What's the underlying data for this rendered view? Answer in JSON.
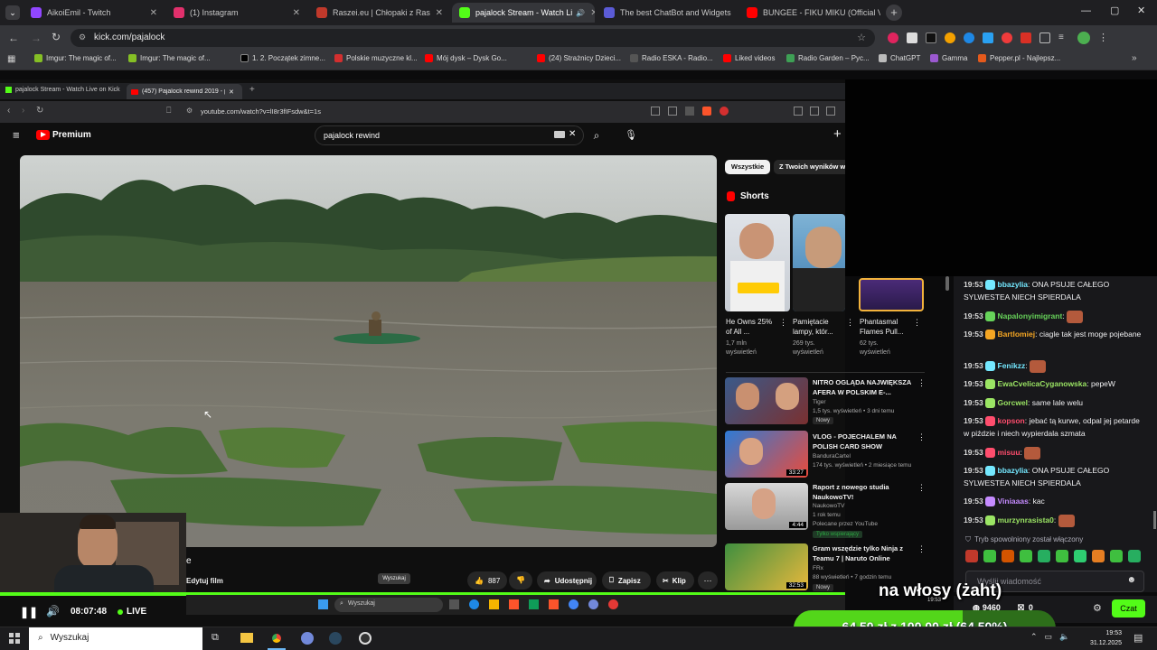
{
  "browser_tabs": [
    {
      "label": "AikoiEmil - Twitch",
      "color": "#9146ff"
    },
    {
      "label": "(1) Instagram",
      "color": "#e1306c"
    },
    {
      "label": "Raszei.eu | Chłopaki z Raszei Lin",
      "color": "#c0392b"
    },
    {
      "label": "pajalock Stream - Watch Li",
      "color": "#53fc18"
    },
    {
      "label": "The best ChatBot and Widgets",
      "color": "#5b5bd6"
    },
    {
      "label": "BUNGEE - FIKU MIKU (Official V",
      "color": "#ff0000"
    }
  ],
  "address": {
    "url": "kick.com/pajalock"
  },
  "bookmarks": [
    "Imgur: The magic of...",
    "Imgur: The magic of...",
    "1. 2. Początek zimne...",
    "Polskie muzyczne kl...",
    "Mój dysk – Dysk Go...",
    "(24) Strażnicy Dzieci...",
    "Radio ESKA - Radio...",
    "Liked videos",
    "Radio Garden – Pyc...",
    "ChatGPT",
    "Gamma",
    "Pepper.pl - Najlepsz..."
  ],
  "inner": {
    "tabs": [
      "pajalock Stream - Watch Live on Kick",
      "(457) Pajalock rewind 2019 - po"
    ],
    "url": "youtube.com/watch?v=lI8r3fIFsdw&t=1s",
    "yt_logo": "Premium",
    "search_value": "pajalock rewind",
    "filters": [
      "Wszystkie",
      "Z Twoich wyników wy"
    ],
    "shorts_title": "Shorts",
    "shorts": [
      {
        "title": "He Owns 25% of All ...",
        "views": "1,7 mln wyświetleń"
      },
      {
        "title": "Pamiętacie lampy, któr...",
        "views": "269 tys. wyświetleń"
      },
      {
        "title": "Phantasmal Flames Pull...",
        "views": "62 tys. wyświetleń"
      }
    ],
    "related": [
      {
        "title": "NITRO OGLĄDA NAJWIĘKSZA AFERA W POLSKIM E-...",
        "channel": "Tiger",
        "meta": "1,5 tys. wyświetleń • 3 dni temu",
        "badge": "Nowy"
      },
      {
        "title": "VLOG - POJECHALEM NA POLISH CARD SHOW",
        "channel": "BanduraCartel",
        "meta": "174 tys. wyświetleń • 2 miesiące temu",
        "duration": "33:27"
      },
      {
        "title": "Raport z nowego studia NaukowoTV!",
        "channel": "NaukowoTV",
        "meta": "1 rok temu",
        "note": "Polecane przez YouTube",
        "badge": "Tylko wspierający",
        "duration": "4:44"
      },
      {
        "title": "Gram wszędzie tylko Ninja z Teamu 7 | Naruto Online",
        "channel": "FRx",
        "meta": "88 wyświetleń • 7 godzin temu",
        "badge": "Nowy",
        "duration": "32:53"
      }
    ],
    "actions": {
      "edit": "Edytuj film",
      "likes": "887",
      "share": "Udostępnij",
      "save": "Zapisz",
      "clip": "Klip"
    },
    "tooltip": "Wyszukaj",
    "inner_search": "Wyszukaj"
  },
  "chat": [
    {
      "time": "19:53",
      "user": "bbazylia",
      "color": "#74e8ff",
      "text": "ONA PSUJE CAŁEGO SYLWESTEA NIECH SPIERDALA"
    },
    {
      "time": "19:53",
      "user": "Napalonyimigrant",
      "color": "#67d35a",
      "text": ""
    },
    {
      "time": "19:53",
      "user": "Bartlomiej",
      "color": "#f5a623",
      "text": "ciagle tak jest moge pojebane"
    },
    {
      "time": "19:53",
      "user": "Fenikzz",
      "color": "#74e8ff",
      "text": ""
    },
    {
      "time": "19:53",
      "user": "EwaCvelicaCyganowska",
      "color": "#9be564",
      "text": "pepeW"
    },
    {
      "time": "19:53",
      "user": "Gorcwel",
      "color": "#9be564",
      "text": "same lale welu"
    },
    {
      "time": "19:53",
      "user": "kopson",
      "color": "#ff4d6d",
      "text": "jebać tą kurwe, odpal jej petarde w piździe i niech wypierdala szmata"
    },
    {
      "time": "19:53",
      "user": "misuu",
      "color": "#ff4d6d",
      "text": ""
    },
    {
      "time": "19:53",
      "user": "bbazylia",
      "color": "#74e8ff",
      "text": "ONA PSUJE CAŁEGO SYLWESTEA NIECH SPIERDALA"
    },
    {
      "time": "19:53",
      "user": "Viniaaas",
      "color": "#c58bff",
      "text": "kac"
    },
    {
      "time": "19:53",
      "user": "murzynrasista0",
      "color": "#9be564",
      "text": ""
    }
  ],
  "chat_notice": "Tryb spowolniony został włączony",
  "chat_input_placeholder": "Wyślij wiadomość",
  "chat_points": "9460",
  "chat_gift_count": "0",
  "chat_button": "Czat",
  "overlay_caption": "na włosy (żaht)",
  "goal": {
    "text": "64,50 zł z 100,00 zł (64.50%)",
    "progress": 0.645
  },
  "player": {
    "time": "08:07:48",
    "live": "LIVE"
  },
  "taskbar": {
    "search": "Wyszukaj",
    "time": "19:53",
    "date": "31.12.2025"
  },
  "inner_taskbar_time": "19:53"
}
